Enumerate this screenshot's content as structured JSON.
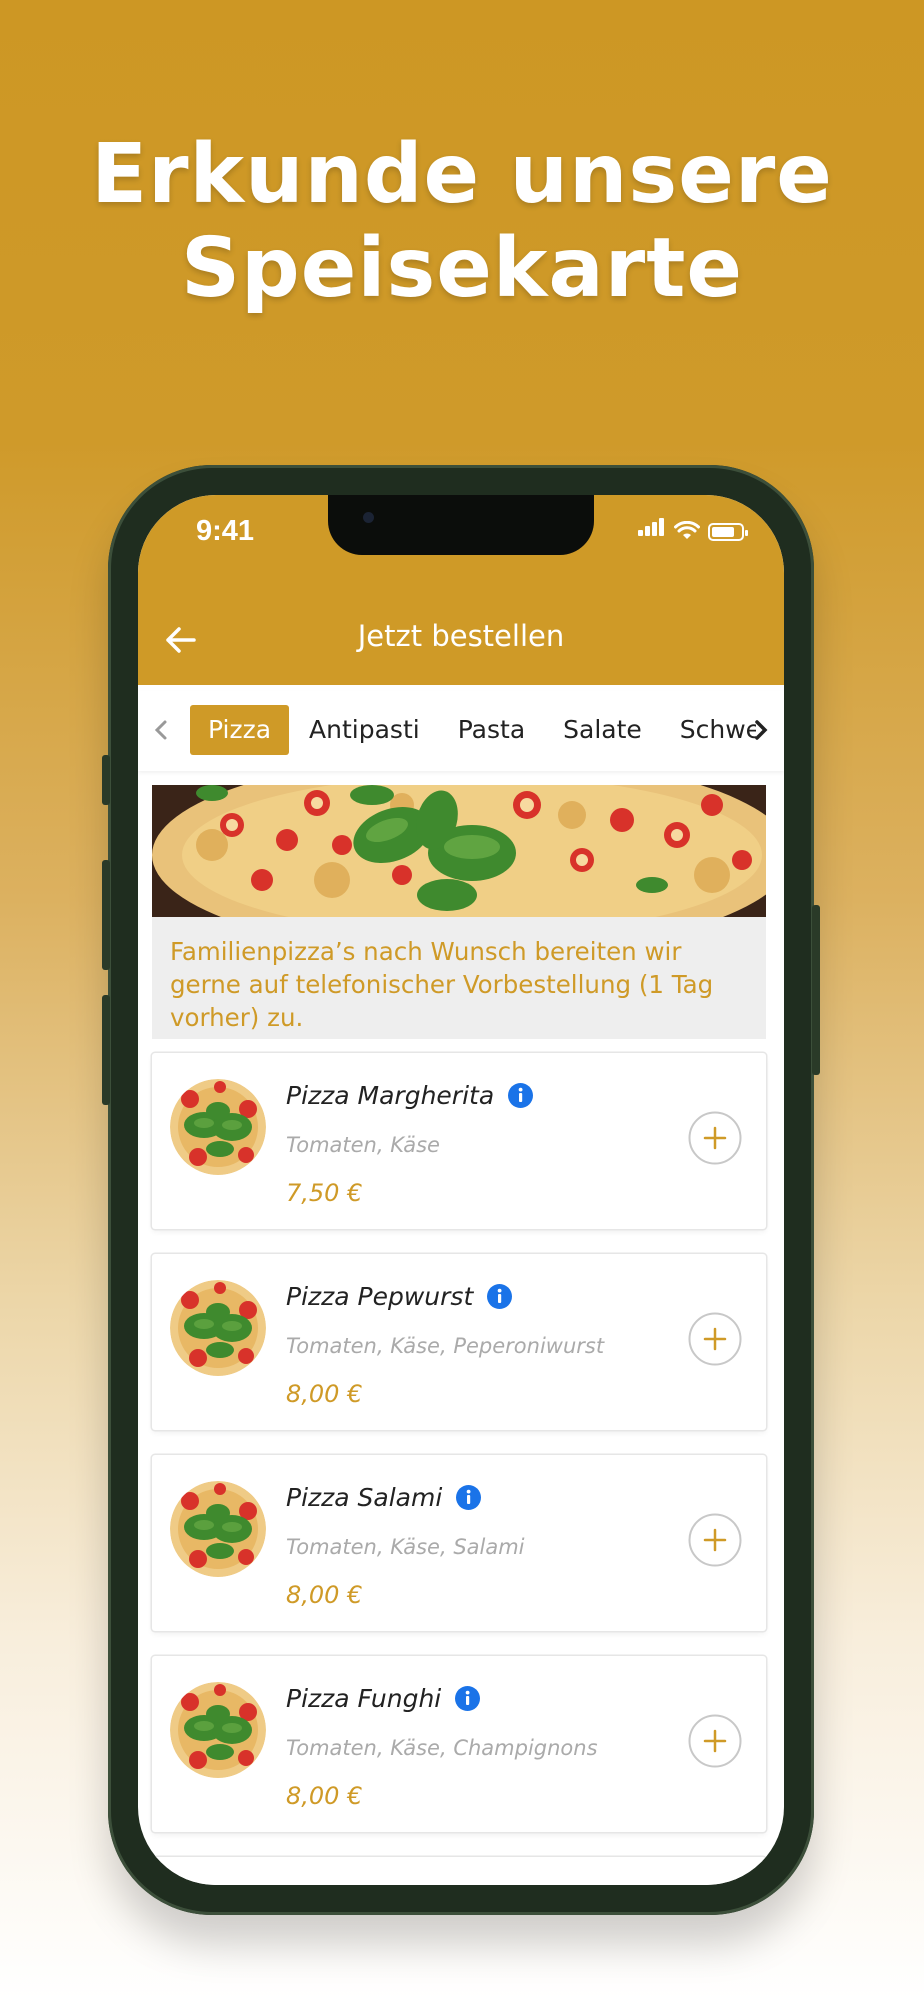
{
  "headline": {
    "line1": "Erkunde unsere",
    "line2": "Speisekarte"
  },
  "status_bar": {
    "time": "9:41"
  },
  "app_bar": {
    "title": "Jetzt bestellen",
    "back_icon": "arrow-left-icon"
  },
  "tabs": {
    "prev_icon": "chevron-left-icon",
    "next_icon": "chevron-right-icon",
    "items": [
      "Pizza",
      "Antipasti",
      "Pasta",
      "Salate",
      "Schwe"
    ],
    "active": "Pizza"
  },
  "notice": {
    "text": "Familienpizza’s nach Wunsch bereiten wir gerne auf telefonischer Vorbestellung (1 Tag vorher) zu."
  },
  "menu_items": [
    {
      "name": "Pizza Margherita",
      "description": "Tomaten, Käse",
      "price": "7,50 €"
    },
    {
      "name": "Pizza Pepwurst",
      "description": "Tomaten, Käse, Peperoniwurst",
      "price": "8,00 €"
    },
    {
      "name": "Pizza Salami",
      "description": "Tomaten, Käse, Salami",
      "price": "8,00 €"
    },
    {
      "name": "Pizza Funghi",
      "description": "Tomaten, Käse, Champignons",
      "price": "8,00 €"
    }
  ],
  "colors": {
    "brand": "#cf9a27",
    "info_blue": "#1a73e8",
    "text_dark": "#222222",
    "text_muted": "#aaaaaa"
  }
}
